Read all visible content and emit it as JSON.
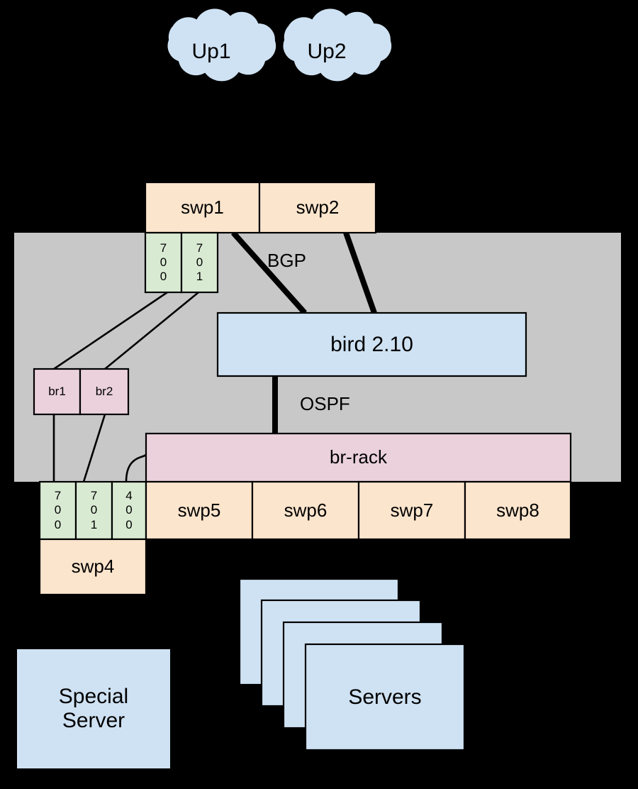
{
  "diagram": {
    "title": "network-topology",
    "background_color": "#000000",
    "colors": {
      "cloud_fill": "#cfe2f3",
      "switch_fill": "#fce5cd",
      "vlan_fill": "#d9ead3",
      "bridge_fill": "#ead1dc",
      "host_fill": "#cfe2f3",
      "container_fill": "#c8c8c8",
      "stroke": "#000000"
    }
  },
  "clouds": [
    {
      "label": "Up1"
    },
    {
      "label": "Up2"
    }
  ],
  "uplink_switches": [
    {
      "label": "swp1"
    },
    {
      "label": "swp2"
    }
  ],
  "uplink_vlans": [
    {
      "id": "700",
      "digits": [
        "7",
        "0",
        "0"
      ]
    },
    {
      "id": "701",
      "digits": [
        "7",
        "0",
        "1"
      ]
    }
  ],
  "bridges": [
    {
      "label": "br1"
    },
    {
      "label": "br2"
    }
  ],
  "daemon": {
    "label": "bird 2.10"
  },
  "rack_bridge": {
    "label": "br-rack"
  },
  "rack_vlans": [
    {
      "id": "700",
      "digits": [
        "7",
        "0",
        "0"
      ]
    },
    {
      "id": "701",
      "digits": [
        "7",
        "0",
        "1"
      ]
    },
    {
      "id": "400",
      "digits": [
        "4",
        "0",
        "0"
      ]
    }
  ],
  "rack_switches": [
    {
      "label": "swp5"
    },
    {
      "label": "swp6"
    },
    {
      "label": "swp7"
    },
    {
      "label": "swp8"
    }
  ],
  "special_switch": {
    "label": "swp4"
  },
  "hosts": [
    {
      "label": "Special\nServer"
    },
    {
      "label": "Servers"
    }
  ],
  "protocol_labels": [
    {
      "label": "BGP"
    },
    {
      "label": "OSPF"
    }
  ]
}
